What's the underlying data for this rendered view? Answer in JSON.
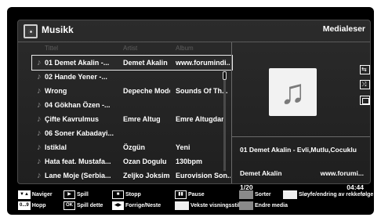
{
  "window": {
    "title": "Musikk",
    "right_title": "Medialeser"
  },
  "columns": {
    "title": "Tittel",
    "artist": "Artist",
    "album": "Album"
  },
  "tracks": [
    {
      "title": "01 Demet Akalin -...",
      "artist": "Demet Akalin",
      "album": "www.forumindi...",
      "selected": true
    },
    {
      "title": "02 Hande Yener -...",
      "artist": "",
      "album": ""
    },
    {
      "title": "Wrong",
      "artist": "Depeche Mode",
      "album": "Sounds Of Th..."
    },
    {
      "title": "04 Gökhan Özen -...",
      "artist": "",
      "album": ""
    },
    {
      "title": "Çifte Kavrulmus",
      "artist": "Emre Altug",
      "album": "Emre Altugdan"
    },
    {
      "title": "06 Soner Kabadayi...",
      "artist": "",
      "album": ""
    },
    {
      "title": "Istiklal",
      "artist": "Özgün",
      "album": "Yeni"
    },
    {
      "title": "Hata feat. Mustafa...",
      "artist": "Ozan Dogulu",
      "album": "130bpm"
    },
    {
      "title": "Lane Moje (Serbia...",
      "artist": "Zeljko Joksimo...",
      "album": "Eurovision Son..."
    }
  ],
  "now_playing": {
    "title": "01 Demet Akalin - Evli,Mutlu,Cocuklu",
    "artist": "Demet Akalin",
    "album": "www.forumi...",
    "index": "1/20",
    "time": "04:44"
  },
  "icons": {
    "title": "media-icon",
    "track": "music-note-icon",
    "art": "music-note-icon",
    "side": [
      "repeat-icon",
      "shuffle-icon",
      "stop-icon"
    ]
  },
  "legend": {
    "navigate": "Naviger",
    "play": "Spill",
    "stop": "Stopp",
    "pause": "Pause",
    "sort": "Sorter",
    "loop": "Sløyfe/endring av rekkefølge",
    "jump_key": "0...9",
    "jump": "Hopp",
    "ok_key": "OK",
    "play_this": "Spill dette",
    "prev_next": "Forrige/Neste",
    "view_style": "Vekste visningsstil",
    "change_media": "Endre media"
  },
  "colors": {
    "background": "#000000",
    "panel": "#262626",
    "text": "#ffffff",
    "column_header": "#5e5e5e",
    "gray_key": "#8a8a8a"
  }
}
